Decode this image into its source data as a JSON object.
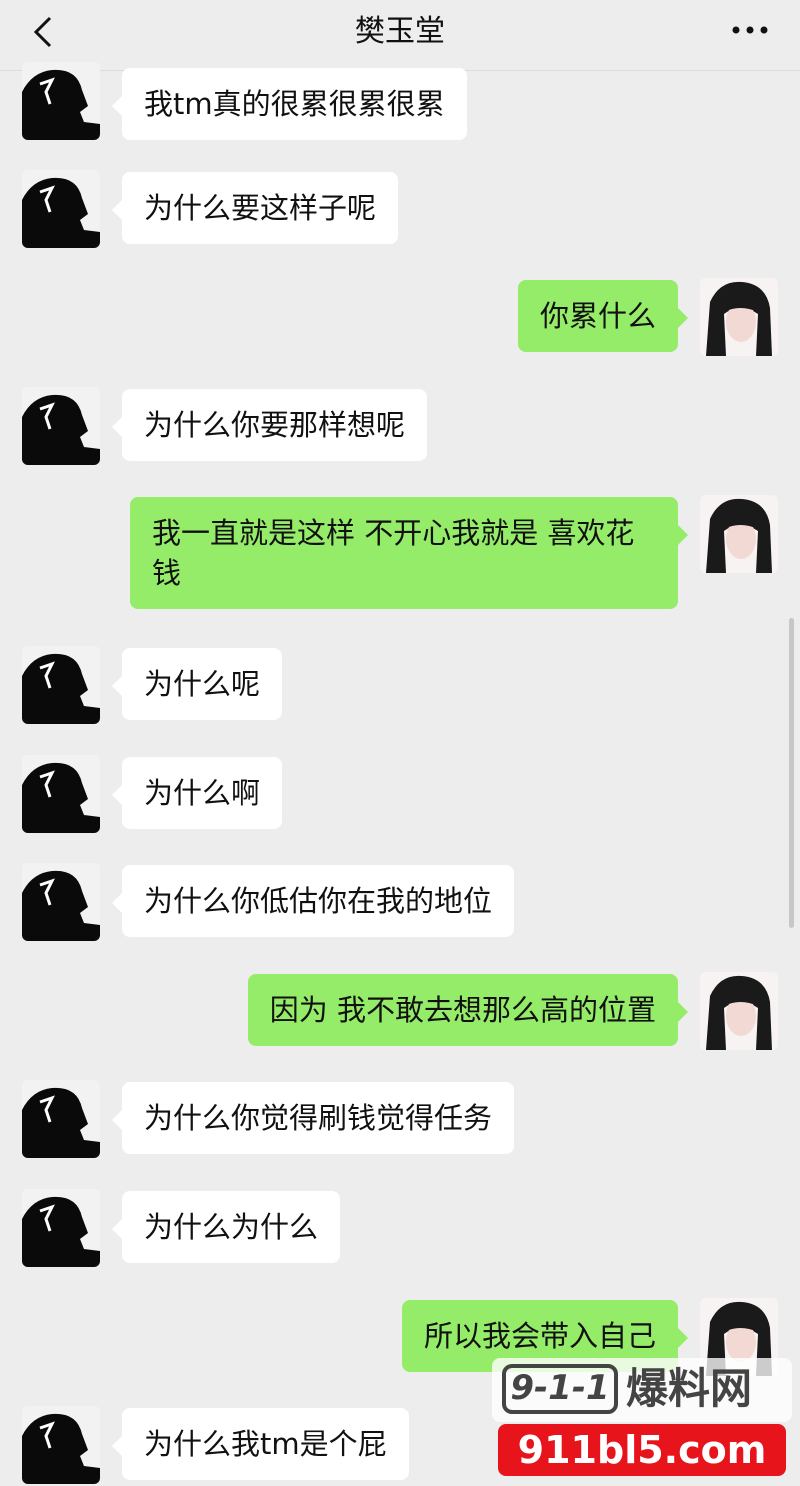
{
  "nav": {
    "title": "樊玉堂"
  },
  "messages": [
    {
      "side": "left",
      "text": "我tm真的很累很累很累"
    },
    {
      "side": "left",
      "text": "为什么要这样子呢"
    },
    {
      "side": "right",
      "text": "你累什么"
    },
    {
      "side": "left",
      "text": "为什么你要那样想呢"
    },
    {
      "side": "right",
      "text": "我一直就是这样 不开心我就是 喜欢花钱"
    },
    {
      "side": "left",
      "text": "为什么呢"
    },
    {
      "side": "left",
      "text": "为什么啊"
    },
    {
      "side": "left",
      "text": "为什么你低估你在我的地位"
    },
    {
      "side": "right",
      "text": "因为 我不敢去想那么高的位置"
    },
    {
      "side": "left",
      "text": "为什么你觉得刷钱觉得任务"
    },
    {
      "side": "left",
      "text": "为什么为什么"
    },
    {
      "side": "right",
      "text": "所以我会带入自己"
    },
    {
      "side": "left",
      "text": "为什么我tm是个屁"
    }
  ],
  "watermark": {
    "brand": "9-1-1",
    "name": "爆料网",
    "url": "911bl5.com"
  },
  "colors": {
    "background": "#ededed",
    "sent": "#95ec69",
    "received": "#ffffff"
  }
}
